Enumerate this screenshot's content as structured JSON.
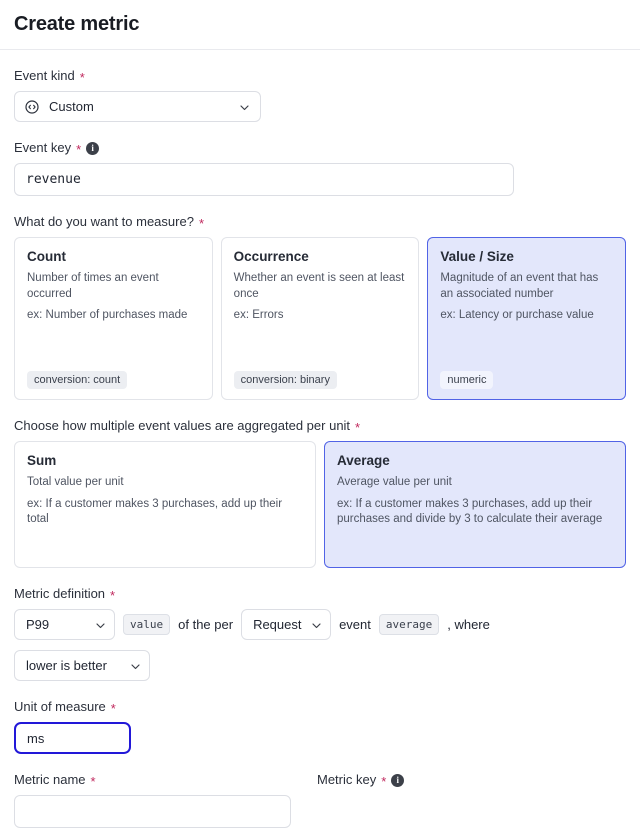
{
  "header": {
    "title": "Create metric"
  },
  "colors": {
    "accent_selected_bg": "#e3e7fb",
    "accent_selected_border": "#5163e6",
    "focus_border": "#2218d8",
    "required_star": "#c0285d",
    "pill_bg": "#eceef2"
  },
  "event_kind": {
    "label": "Event kind",
    "required_marker": "*",
    "icon": "custom-circle-icon",
    "value": "Custom",
    "chevron": "chevron-down-icon"
  },
  "event_key": {
    "label": "Event key",
    "required_marker": "*",
    "info_icon": "info-icon",
    "info_glyph": "i",
    "value": "revenue",
    "placeholder": "revenue"
  },
  "measure": {
    "label": "What do you want to measure?",
    "required_marker": "*",
    "options": [
      {
        "title": "Count",
        "desc": "Number of times an event occurred",
        "example": "ex: Number of purchases made",
        "pill": "conversion: count",
        "selected": false
      },
      {
        "title": "Occurrence",
        "desc": "Whether an event is seen at least once",
        "example": "ex: Errors",
        "pill": "conversion: binary",
        "selected": false
      },
      {
        "title": "Value / Size",
        "desc": "Magnitude of an event that has an associated number",
        "example": "ex: Latency or purchase value",
        "pill": "numeric",
        "selected": true
      }
    ]
  },
  "aggregation": {
    "label": "Choose how multiple event values are aggregated per unit",
    "required_marker": "*",
    "options": [
      {
        "title": "Sum",
        "desc": "Total value per unit",
        "example": "ex: If a customer makes 3 purchases, add up their total",
        "selected": false
      },
      {
        "title": "Average",
        "desc": "Average value per unit",
        "example": "ex: If a customer makes 3 purchases, add up their purchases and divide by 3 to calculate their average",
        "selected": true
      }
    ]
  },
  "metric_definition": {
    "label": "Metric definition",
    "required_marker": "*",
    "percentile_value": "P99",
    "value_chip": "value",
    "text_of_the_per": "of the per",
    "unit_value": "Request",
    "text_event": "event",
    "average_chip": "average",
    "text_where": ", where",
    "direction_value": "lower is better"
  },
  "unit_of_measure": {
    "label": "Unit of measure",
    "required_marker": "*",
    "value": "ms",
    "placeholder": "ms",
    "focused": true
  },
  "metric_name": {
    "label": "Metric name",
    "required_marker": "*",
    "value": "",
    "placeholder": ""
  },
  "metric_key": {
    "label": "Metric key",
    "required_marker": "*",
    "info_icon": "info-icon",
    "info_glyph": "i"
  }
}
